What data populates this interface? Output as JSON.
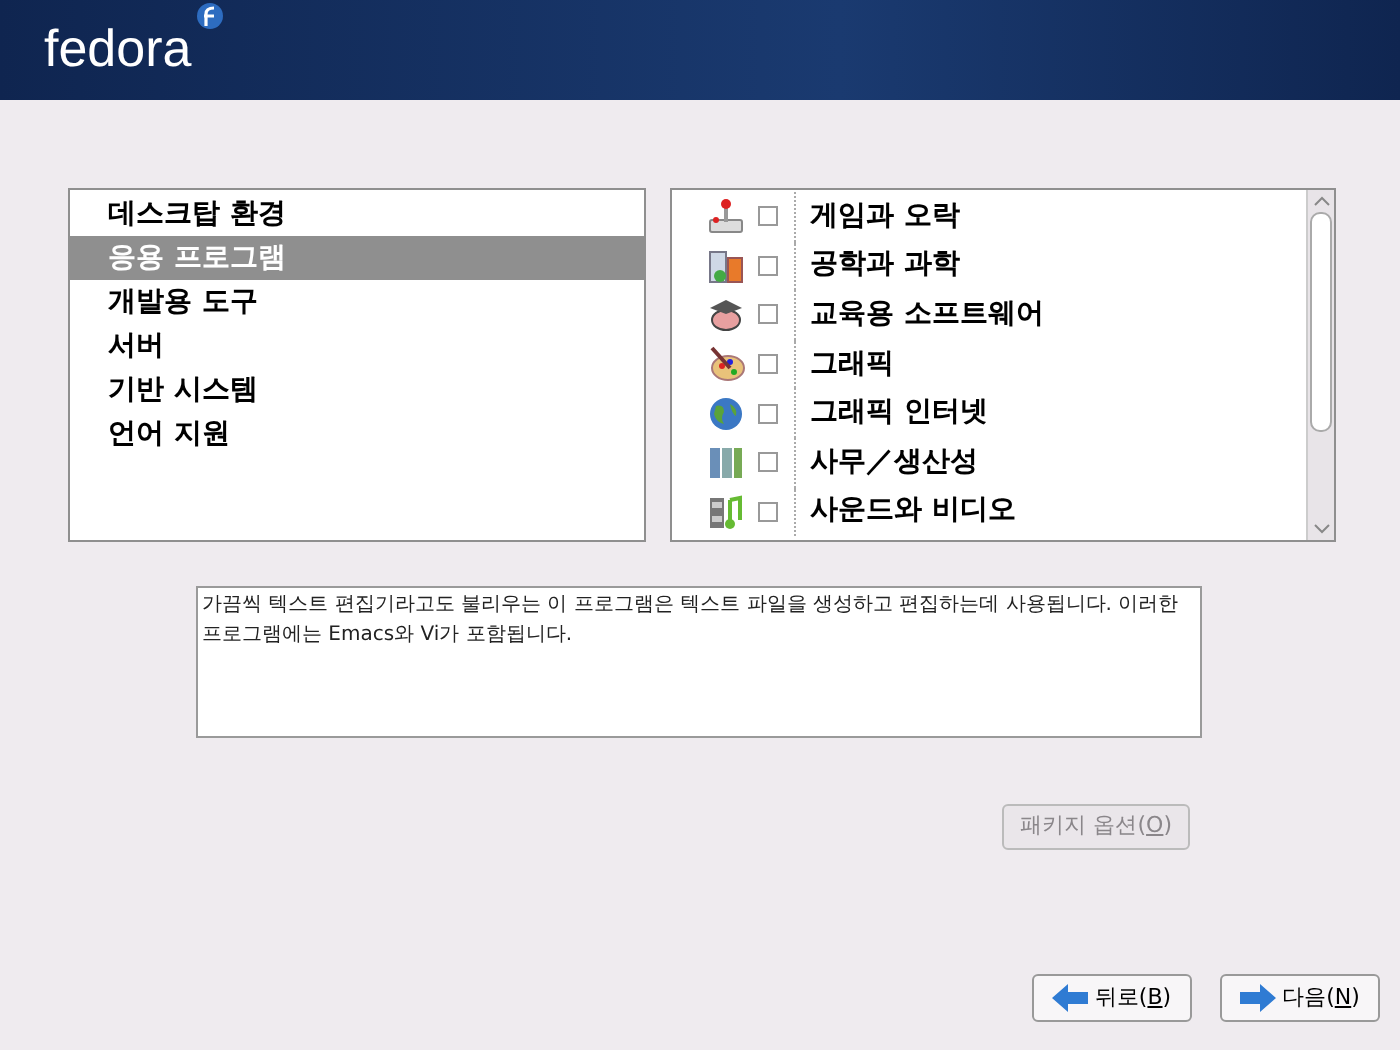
{
  "header": {
    "logo": "fedora"
  },
  "groups": [
    {
      "label": "데스크탑 환경",
      "selected": false
    },
    {
      "label": "응용 프로그램",
      "selected": true
    },
    {
      "label": "개발용 도구",
      "selected": false
    },
    {
      "label": "서버",
      "selected": false
    },
    {
      "label": "기반 시스템",
      "selected": false
    },
    {
      "label": "언어 지원",
      "selected": false
    }
  ],
  "categories": [
    {
      "kind": "game",
      "label": "게임과 오락",
      "checked": false
    },
    {
      "kind": "science",
      "label": "공학과 과학",
      "checked": false
    },
    {
      "kind": "education",
      "label": "교육용 소프트웨어",
      "checked": false
    },
    {
      "kind": "graphics",
      "label": "그래픽",
      "checked": false
    },
    {
      "kind": "internet",
      "label": "그래픽 인터넷",
      "checked": false
    },
    {
      "kind": "office",
      "label": "사무／생산성",
      "checked": false
    },
    {
      "kind": "media",
      "label": "사운드와 비디오",
      "checked": false
    }
  ],
  "description": "가끔씩 텍스트 편집기라고도 불리우는 이 프로그램은 텍스트 파일을 생성하고 편집하는데 사용됩니다. 이러한 프로그램에는 Emacs와 Vi가 포함됩니다.",
  "package_options": {
    "label_start": "패키지 옵션(",
    "mnemonic": "O",
    "label_end": ")",
    "disabled": true
  },
  "buttons": [
    {
      "kind": "back",
      "label_start": "뒤로(",
      "mnemonic": "B",
      "label_end": ")"
    },
    {
      "kind": "next",
      "label_start": "다음(",
      "mnemonic": "N",
      "label_end": ")"
    }
  ]
}
